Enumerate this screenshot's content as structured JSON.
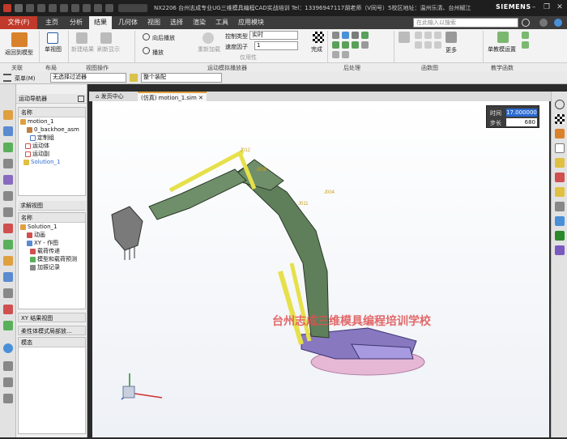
{
  "titlebar": {
    "title": "NX2206 台州志成专业UG三维模具编程CAD实战培训 Tel：13396947117胡老师（V同号）5校区地址：温州乐清、台州椒江",
    "brand": "SIEMENS"
  },
  "menu": {
    "file": "文件(F)",
    "items": [
      "主页",
      "分析",
      "结果",
      "几何体",
      "视图",
      "选择",
      "渲染",
      "工具",
      "应用模块"
    ],
    "search_placeholder": "在此输入以搜索"
  },
  "ribbon": {
    "buttons": {
      "return": "返回到模型",
      "single_view": "单视图",
      "new_result": "新建结果",
      "refresh": "刷新显示",
      "play_back": "向后播放",
      "play": "播放",
      "reset": "重新加载",
      "finish": "完成",
      "more": "更多",
      "teach": "单教模运置",
      "layers": "仅用性"
    },
    "control_type_label": "控制类型",
    "control_type_value": "实时",
    "speed_label": "速度因子",
    "speed_value": "1",
    "groups": [
      "关联",
      "布局",
      "视图操作",
      "运动模拟播放器",
      "后处理",
      "函数图",
      "教学函数"
    ]
  },
  "filterbar": {
    "menu": "菜单(M)",
    "filter": "无选择过滤器",
    "assembly": "整个装配"
  },
  "navigator": {
    "title": "运动导航器",
    "col_name": "名称",
    "tree": [
      "motion_1",
      "0_backhoe_asm",
      "定制组",
      "运动体",
      "运动副",
      "Solution_1"
    ],
    "solution_title": "求解视图",
    "solution_col": "名称",
    "solution_tree": [
      "Solution_1",
      "动画",
      "XY - 作图",
      "载荷传递",
      "模型和载荷预测",
      "加振记录"
    ],
    "xy_view": "XY 结果视图",
    "flex": "柔性体模式局部放...",
    "state_col": "模态"
  },
  "tabs": {
    "home": "发页中心",
    "sim": "(仿真) motion_1.sim"
  },
  "timebox": {
    "time_label": "时间",
    "time_value": "17.000000",
    "step_label": "步长",
    "step_value": "680"
  },
  "watermark": "台州志成三维模具编程培训学校",
  "labels": {
    "j004": "J004",
    "j008": "J008",
    "j011": "J011",
    "j012": "J012"
  },
  "colors": {
    "brand_red": "#c0392b",
    "boom": "#5f7f5a",
    "cylinder": "#e6e04a",
    "base": "#8878c0"
  }
}
